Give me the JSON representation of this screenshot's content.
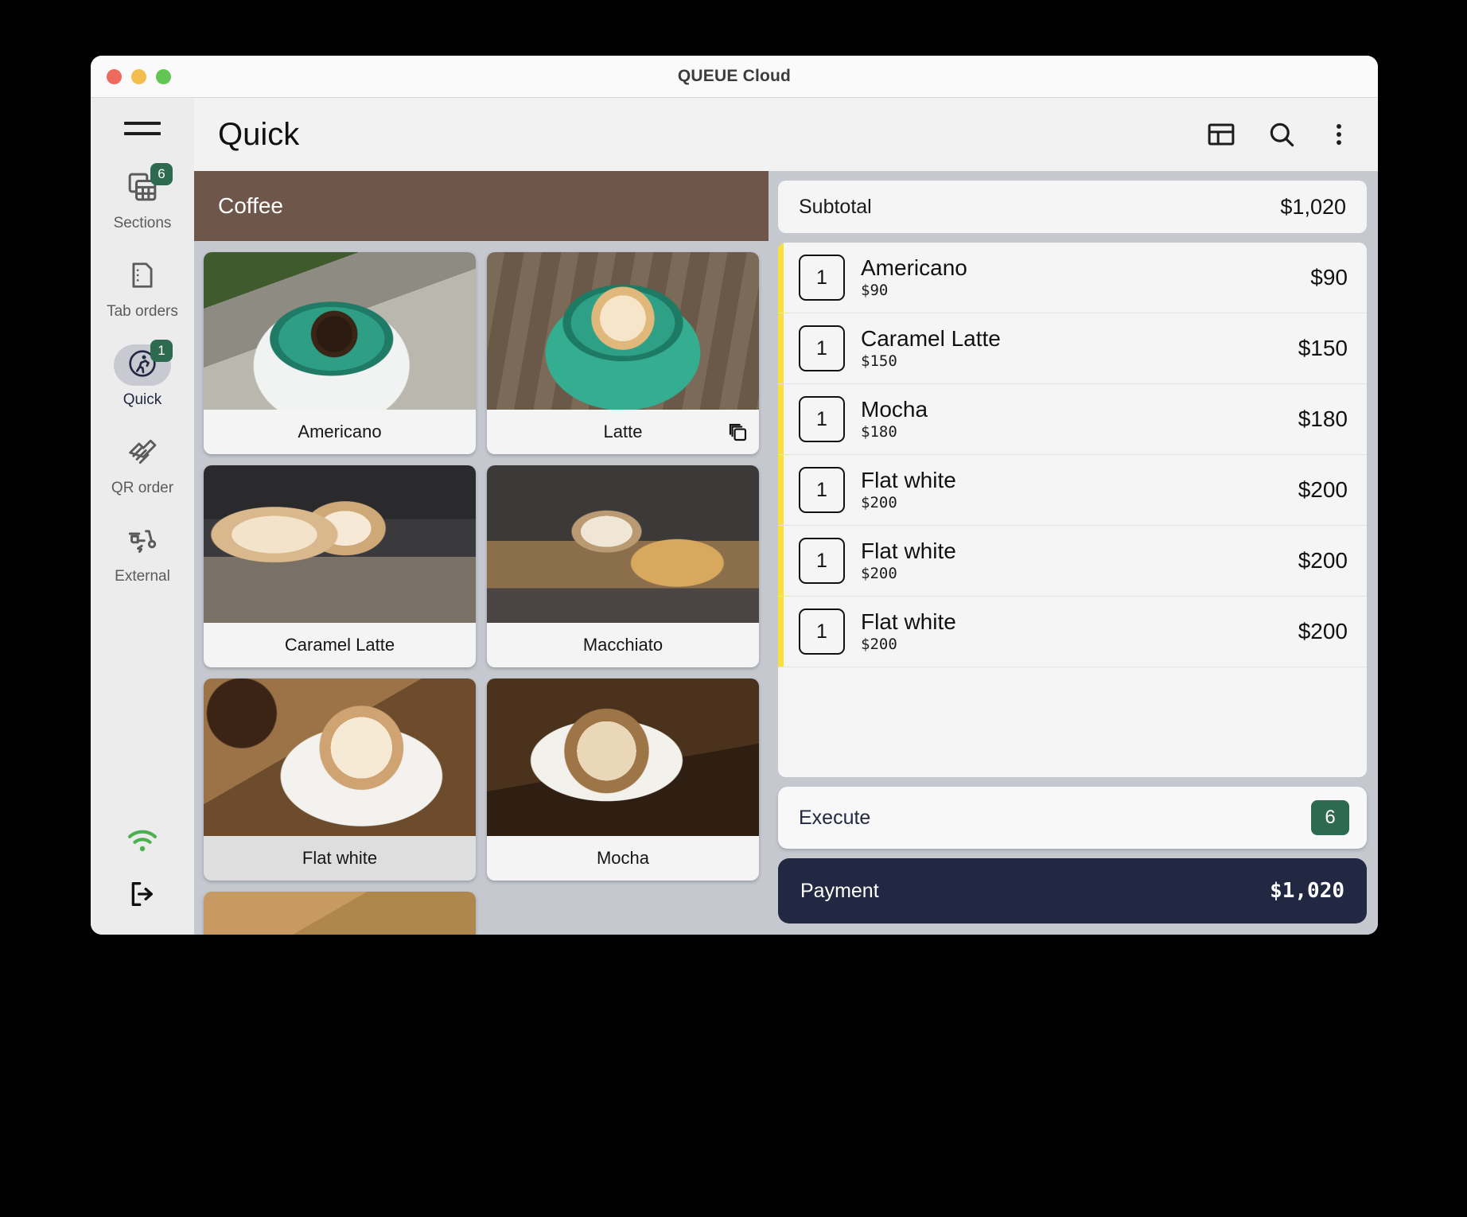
{
  "window": {
    "title": "QUEUE Cloud",
    "traffic_lights": [
      "close-red",
      "minimize-yellow",
      "maximize-green"
    ]
  },
  "sidebar": {
    "menu_icon": "hamburger-icon",
    "items": [
      {
        "label": "Sections",
        "icon": "sections-grid-icon",
        "badge": "6",
        "active": false
      },
      {
        "label": "Tab orders",
        "icon": "document-icon",
        "badge": "",
        "active": false
      },
      {
        "label": "Quick",
        "icon": "running-person-icon",
        "badge": "1",
        "active": true
      },
      {
        "label": "QR order",
        "icon": "handshake-icon",
        "badge": "",
        "active": false
      },
      {
        "label": "External",
        "icon": "scooter-icon",
        "badge": "",
        "active": false
      }
    ],
    "bottom": [
      {
        "name": "wifi-icon",
        "color": "#4caf50"
      },
      {
        "name": "logout-icon",
        "color": "#111111"
      }
    ]
  },
  "header": {
    "title": "Quick",
    "actions": [
      {
        "name": "layout-split-icon"
      },
      {
        "name": "search-icon"
      },
      {
        "name": "more-vertical-icon"
      }
    ]
  },
  "catalog": {
    "category": "Coffee",
    "category_color": "#6e564b",
    "products": [
      {
        "name": "Americano",
        "image": "ph-americano",
        "variants": false,
        "pressed": false
      },
      {
        "name": "Latte",
        "image": "ph-latte",
        "variants": true,
        "pressed": false
      },
      {
        "name": "Caramel Latte",
        "image": "ph-caramel",
        "variants": false,
        "pressed": false
      },
      {
        "name": "Macchiato",
        "image": "ph-macchiato",
        "variants": false,
        "pressed": false
      },
      {
        "name": "Flat white",
        "image": "ph-flatwhite",
        "variants": false,
        "pressed": true
      },
      {
        "name": "Mocha",
        "image": "ph-mocha",
        "variants": false,
        "pressed": false
      },
      {
        "name": "",
        "image": "ph-latte2",
        "variants": false,
        "pressed": false
      }
    ]
  },
  "order": {
    "subtotal_label": "Subtotal",
    "subtotal_value": "$1,020",
    "accent_color": "#f9e03c",
    "items": [
      {
        "qty": "1",
        "name": "Americano",
        "unit_price": "$90",
        "line_total": "$90"
      },
      {
        "qty": "1",
        "name": "Caramel Latte",
        "unit_price": "$150",
        "line_total": "$150"
      },
      {
        "qty": "1",
        "name": "Mocha",
        "unit_price": "$180",
        "line_total": "$180"
      },
      {
        "qty": "1",
        "name": "Flat white",
        "unit_price": "$200",
        "line_total": "$200"
      },
      {
        "qty": "1",
        "name": "Flat white",
        "unit_price": "$200",
        "line_total": "$200"
      },
      {
        "qty": "1",
        "name": "Flat white",
        "unit_price": "$200",
        "line_total": "$200"
      }
    ],
    "execute_label": "Execute",
    "execute_count": "6",
    "execute_count_color": "#2d6a4f",
    "payment_label": "Payment",
    "payment_value": "$1,020",
    "payment_color": "#232842"
  }
}
